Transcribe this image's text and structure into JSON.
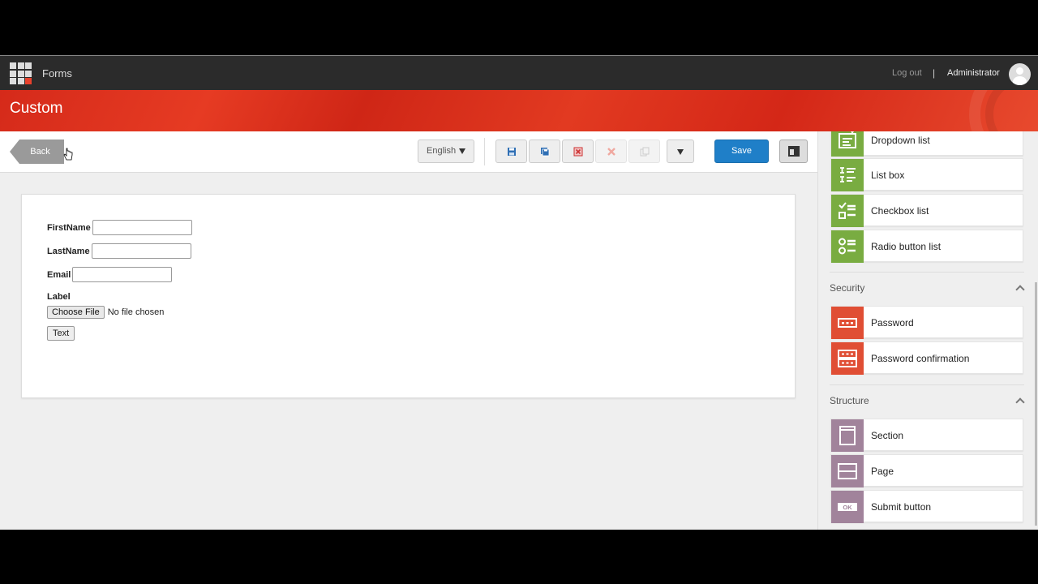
{
  "topbar": {
    "app_title": "Forms",
    "logout_label": "Log out",
    "separator": "|",
    "user_name": "Administrator"
  },
  "header": {
    "page_title": "Custom"
  },
  "toolbar": {
    "back_label": "Back",
    "language": "English",
    "save_label": "Save",
    "icons": [
      "save-icon",
      "save-as-icon",
      "delete-icon",
      "remove-icon",
      "copy-icon",
      "more-caret-icon",
      "panel-toggle-icon"
    ]
  },
  "form": {
    "fields": [
      {
        "label": "FirstName",
        "value": ""
      },
      {
        "label": "LastName",
        "value": ""
      },
      {
        "label": "Email",
        "value": ""
      }
    ],
    "file_label": "Label",
    "choose_file": "Choose File",
    "no_file": "No file chosen",
    "text_button": "Text"
  },
  "sidebar": {
    "list_items": [
      {
        "label": "Dropdown list",
        "icon": "dropdown-list-icon"
      },
      {
        "label": "List box",
        "icon": "list-box-icon"
      },
      {
        "label": "Checkbox list",
        "icon": "checkbox-list-icon"
      },
      {
        "label": "Radio button list",
        "icon": "radio-list-icon"
      }
    ],
    "security": {
      "title": "Security",
      "items": [
        {
          "label": "Password",
          "icon": "password-icon"
        },
        {
          "label": "Password confirmation",
          "icon": "password-confirmation-icon"
        }
      ]
    },
    "structure": {
      "title": "Structure",
      "items": [
        {
          "label": "Section",
          "icon": "section-icon"
        },
        {
          "label": "Page",
          "icon": "page-icon"
        },
        {
          "label": "Submit button",
          "icon": "submit-button-icon",
          "badge": "OK"
        }
      ]
    }
  },
  "colors": {
    "topbar": "#2b2b2b",
    "header_red": "#e03a22",
    "save_blue": "#1f7fc8",
    "list_green": "#79ac41",
    "security_red": "#e04e34",
    "structure_purple": "#a1839b"
  }
}
